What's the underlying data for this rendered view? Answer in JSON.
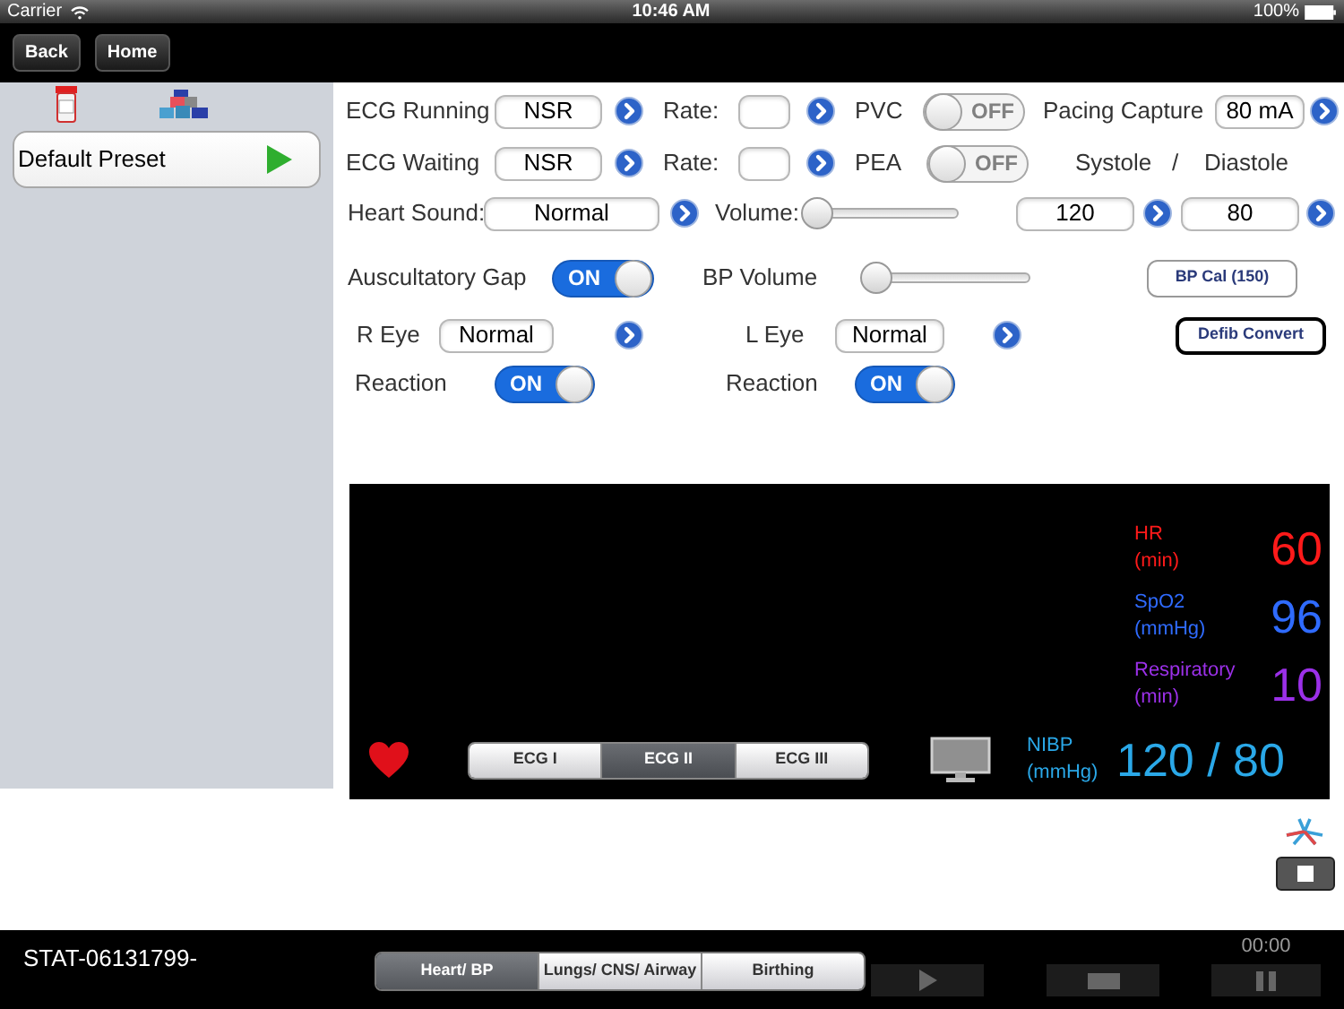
{
  "status_bar": {
    "carrier": "Carrier",
    "time": "10:46 AM",
    "battery": "100%"
  },
  "nav_buttons": [
    "Back",
    "Home"
  ],
  "presets": [
    {
      "label": "Default Preset"
    }
  ],
  "controls": {
    "ecg_running": {
      "label": "ECG Running",
      "value": "NSR"
    },
    "running_rate": {
      "label": "Rate:"
    },
    "pvc": {
      "label": "PVC",
      "on": false,
      "text": "OFF"
    },
    "pacing_capture": {
      "label": "Pacing Capture",
      "value": "80 mA"
    },
    "ecg_waiting": {
      "label": "ECG Waiting",
      "value": "NSR"
    },
    "waiting_rate": {
      "label": "Rate:"
    },
    "pea": {
      "label": "PEA",
      "on": false,
      "text": "OFF"
    },
    "systole_label": "Systole",
    "separator": "/",
    "diastole_label": "Diastole",
    "heart_sound": {
      "label": "Heart Sound:",
      "value": "Normal"
    },
    "volume": {
      "label": "Volume:",
      "level": 0
    },
    "systole": "120",
    "diastole": "80",
    "auscultatory_gap": {
      "label": "Auscultatory Gap",
      "on": true,
      "text": "ON"
    },
    "bp_volume": {
      "label": "BP Volume",
      "level": 0
    },
    "bp_cal_button": "BP Cal (150)",
    "r_eye": {
      "label": "R Eye",
      "value": "Normal"
    },
    "l_eye": {
      "label": "L Eye",
      "value": "Normal"
    },
    "defib_button": "Defib Convert",
    "r_reaction": {
      "label": "Reaction",
      "on": true,
      "text": "ON"
    },
    "l_reaction": {
      "label": "Reaction",
      "on": true,
      "text": "ON"
    }
  },
  "monitor": {
    "vitals": [
      {
        "label": "HR",
        "unit": "(min)",
        "value": "60",
        "color": "#ff1a1a"
      },
      {
        "label": "SpO2",
        "unit": "(mmHg)",
        "value": "96",
        "color": "#2f6bff"
      },
      {
        "label": "Respiratory",
        "unit": "(min)",
        "value": "10",
        "color": "#9b30e8"
      },
      {
        "label": "NIBP",
        "unit": "(mmHg)",
        "value": "120 / 80",
        "color": "#2aa8e8"
      }
    ],
    "leads": [
      {
        "label": "ECG I",
        "selected": false
      },
      {
        "label": "ECG II",
        "selected": true
      },
      {
        "label": "ECG III",
        "selected": false
      }
    ]
  },
  "bottom_bar": {
    "case_id": "STAT-06131799-",
    "timer": "00:00",
    "tabs": [
      {
        "label": "Heart/ BP",
        "selected": true
      },
      {
        "label": "Lungs/ CNS/ Airway",
        "selected": false
      },
      {
        "label": "Birthing",
        "selected": false
      }
    ]
  }
}
